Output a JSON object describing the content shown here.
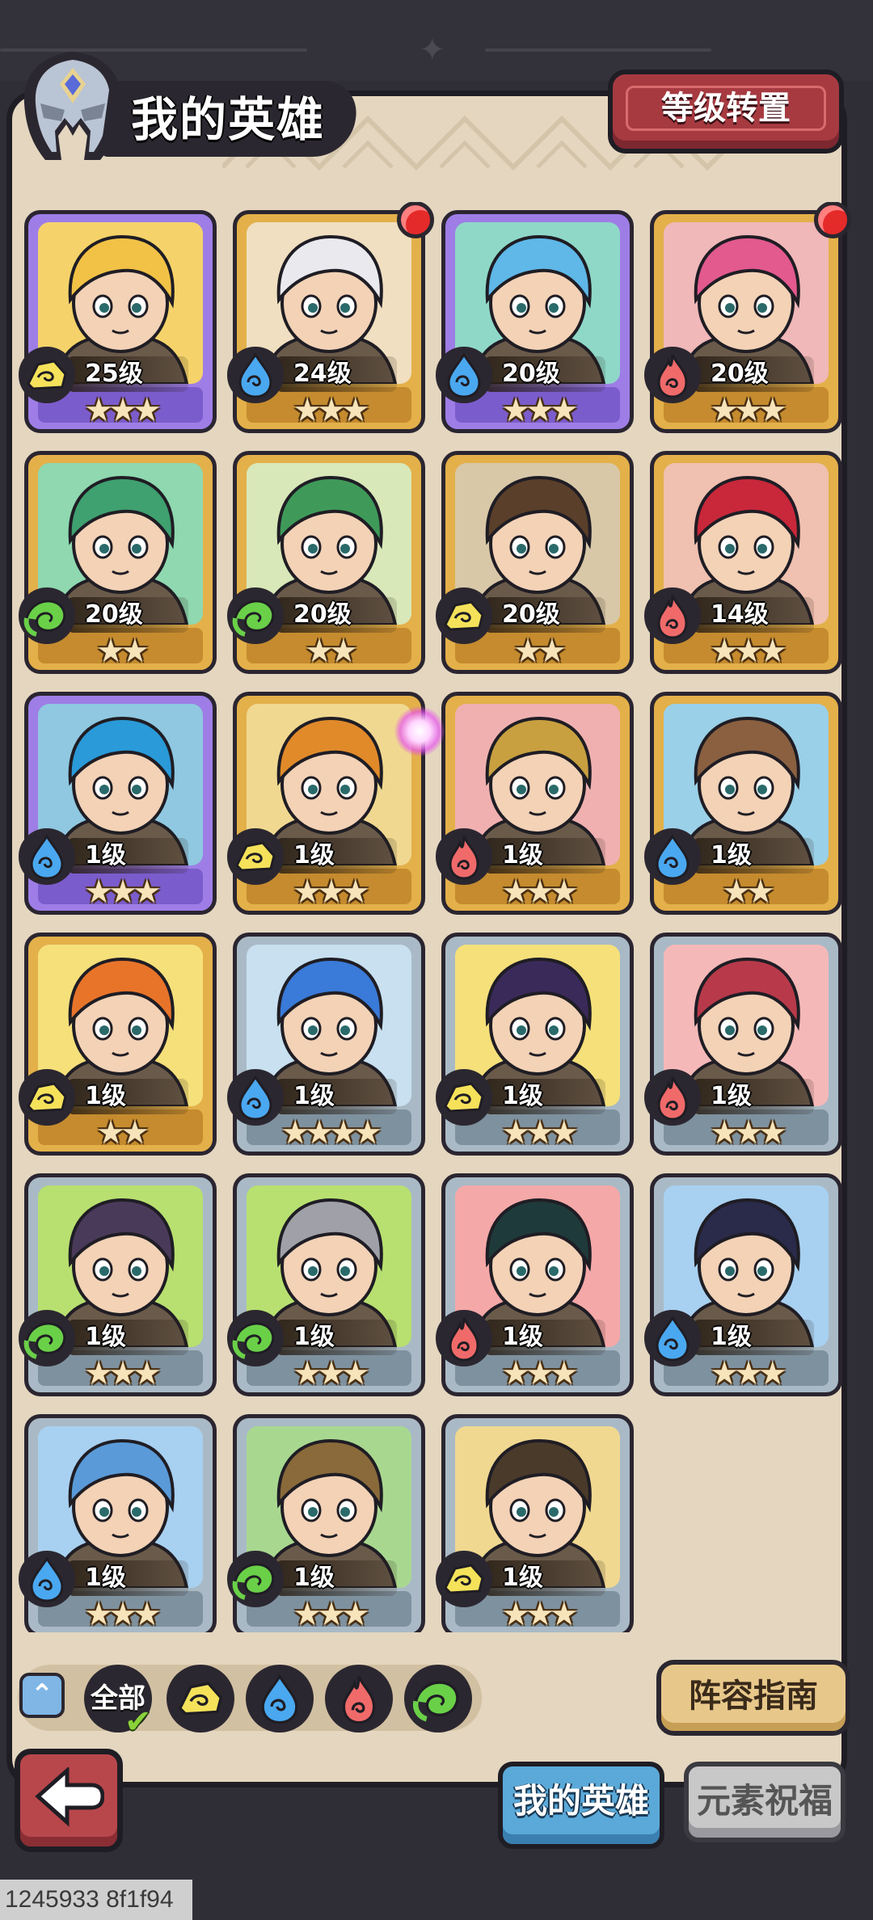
{
  "header": {
    "title": "我的英雄",
    "transfer_button": "等级转置"
  },
  "heroes": [
    {
      "level": "25级",
      "stars": "★★★",
      "element": "earth",
      "rarity": "purple",
      "hair": "#f2c246",
      "bg": "#f5d36a",
      "dot": false
    },
    {
      "level": "24级",
      "stars": "★★★",
      "element": "water",
      "rarity": "gold",
      "hair": "#e9e9ee",
      "bg": "#f0dfc0",
      "dot": true
    },
    {
      "level": "20级",
      "stars": "★★★",
      "element": "water",
      "rarity": "purple",
      "hair": "#5fb8e8",
      "bg": "#8fd8c8",
      "dot": false
    },
    {
      "level": "20级",
      "stars": "★★★",
      "element": "fire",
      "rarity": "gold",
      "hair": "#e25a8e",
      "bg": "#f0b8b8",
      "dot": true
    },
    {
      "level": "20级",
      "stars": "★★",
      "element": "wind",
      "rarity": "gold",
      "hair": "#3fa070",
      "bg": "#8fd8b0",
      "dot": false
    },
    {
      "level": "20级",
      "stars": "★★",
      "element": "wind",
      "rarity": "gold",
      "hair": "#3f9a5a",
      "bg": "#d8e8b8",
      "dot": false
    },
    {
      "level": "20级",
      "stars": "★★",
      "element": "earth",
      "rarity": "gold",
      "hair": "#5a3f2a",
      "bg": "#d8c8a8",
      "dot": false
    },
    {
      "level": "14级",
      "stars": "★★★",
      "element": "fire",
      "rarity": "gold",
      "hair": "#c8283a",
      "bg": "#f0c0b0",
      "dot": false
    },
    {
      "level": "1级",
      "stars": "★★★",
      "element": "water",
      "rarity": "purple",
      "hair": "#2a9ad8",
      "bg": "#8fc8e0",
      "dot": false
    },
    {
      "level": "1级",
      "stars": "★★★",
      "element": "earth",
      "rarity": "gold",
      "hair": "#e08a2a",
      "bg": "#f0d890",
      "dot": false
    },
    {
      "level": "1级",
      "stars": "★★★",
      "element": "fire",
      "rarity": "gold",
      "hair": "#c8a040",
      "bg": "#f0b0b0",
      "dot": false
    },
    {
      "level": "1级",
      "stars": "★★",
      "element": "water",
      "rarity": "gold",
      "hair": "#8a6040",
      "bg": "#9ad0e8",
      "dot": false
    },
    {
      "level": "1级",
      "stars": "★★",
      "element": "earth",
      "rarity": "gold",
      "hair": "#e8742a",
      "bg": "#f5e07a",
      "dot": false
    },
    {
      "level": "1级",
      "stars": "★★★★",
      "element": "water",
      "rarity": "silver",
      "hair": "#3a7ad8",
      "bg": "#c8e0f0",
      "dot": false
    },
    {
      "level": "1级",
      "stars": "★★★",
      "element": "earth",
      "rarity": "silver",
      "hair": "#3a2a5a",
      "bg": "#f5e07a",
      "dot": false
    },
    {
      "level": "1级",
      "stars": "★★★",
      "element": "fire",
      "rarity": "silver",
      "hair": "#b83a4a",
      "bg": "#f5b8b8",
      "dot": false
    },
    {
      "level": "1级",
      "stars": "★★★",
      "element": "wind",
      "rarity": "silver",
      "hair": "#4a3a5a",
      "bg": "#b8e070",
      "dot": false
    },
    {
      "level": "1级",
      "stars": "★★★",
      "element": "wind",
      "rarity": "silver",
      "hair": "#a0a0a8",
      "bg": "#b8e070",
      "dot": false
    },
    {
      "level": "1级",
      "stars": "★★★",
      "element": "fire",
      "rarity": "silver",
      "hair": "#1f3a3a",
      "bg": "#f5a8a8",
      "dot": false
    },
    {
      "level": "1级",
      "stars": "★★★",
      "element": "water",
      "rarity": "silver",
      "hair": "#2a2a4a",
      "bg": "#a8d0f0",
      "dot": false
    },
    {
      "level": "1级",
      "stars": "★★★",
      "element": "water",
      "rarity": "silver",
      "hair": "#5a9ad8",
      "bg": "#a8d0f0",
      "dot": false
    },
    {
      "level": "1级",
      "stars": "★★★",
      "element": "wind",
      "rarity": "silver",
      "hair": "#8a6a3a",
      "bg": "#a8d890",
      "dot": false
    },
    {
      "level": "1级",
      "stars": "★★★",
      "element": "earth",
      "rarity": "silver",
      "hair": "#4a3a2a",
      "bg": "#f0d890",
      "dot": false
    }
  ],
  "filter": {
    "all_label": "全部",
    "chips": [
      "earth",
      "water",
      "fire",
      "wind"
    ]
  },
  "buttons": {
    "guide": "阵容指南"
  },
  "tabs": {
    "my_heroes": "我的英雄",
    "element_blessing": "元素祝福"
  },
  "footer_id": "1245933 8f1f94",
  "colors": {
    "earth": "#f5e25a",
    "water": "#4aa8f0",
    "fire": "#f06a6a",
    "wind": "#6ad048"
  }
}
